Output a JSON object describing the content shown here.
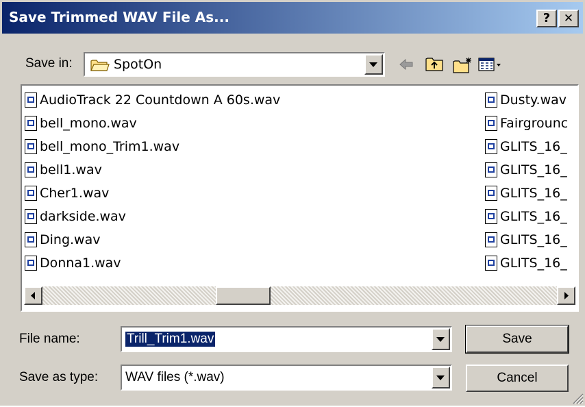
{
  "dialog": {
    "title": "Save Trimmed WAV File As...",
    "help_label": "?",
    "close_label": "✕"
  },
  "save_in": {
    "label": "Save in:",
    "folder": "SpotOn"
  },
  "toolbar": {
    "back_icon": "back-arrow-icon",
    "up_icon": "up-folder-icon",
    "new_folder_icon": "new-folder-icon",
    "view_menu_icon": "view-menu-icon"
  },
  "files": {
    "column1": [
      "AudioTrack 22 Countdown A 60s.wav",
      "bell_mono.wav",
      "bell_mono_Trim1.wav",
      "bell1.wav",
      "Cher1.wav",
      "darkside.wav",
      "Ding.wav",
      "Donna1.wav"
    ],
    "column2": [
      "Dusty.wav",
      "Fairgrounc",
      "GLITS_16_",
      "GLITS_16_",
      "GLITS_16_",
      "GLITS_16_",
      "GLITS_16_",
      "GLITS_16_"
    ]
  },
  "file_name": {
    "label": "File name:",
    "value": "Trill_Trim1.wav"
  },
  "save_as_type": {
    "label": "Save as type:",
    "value": "WAV files (*.wav)"
  },
  "buttons": {
    "save": "Save",
    "cancel": "Cancel"
  }
}
